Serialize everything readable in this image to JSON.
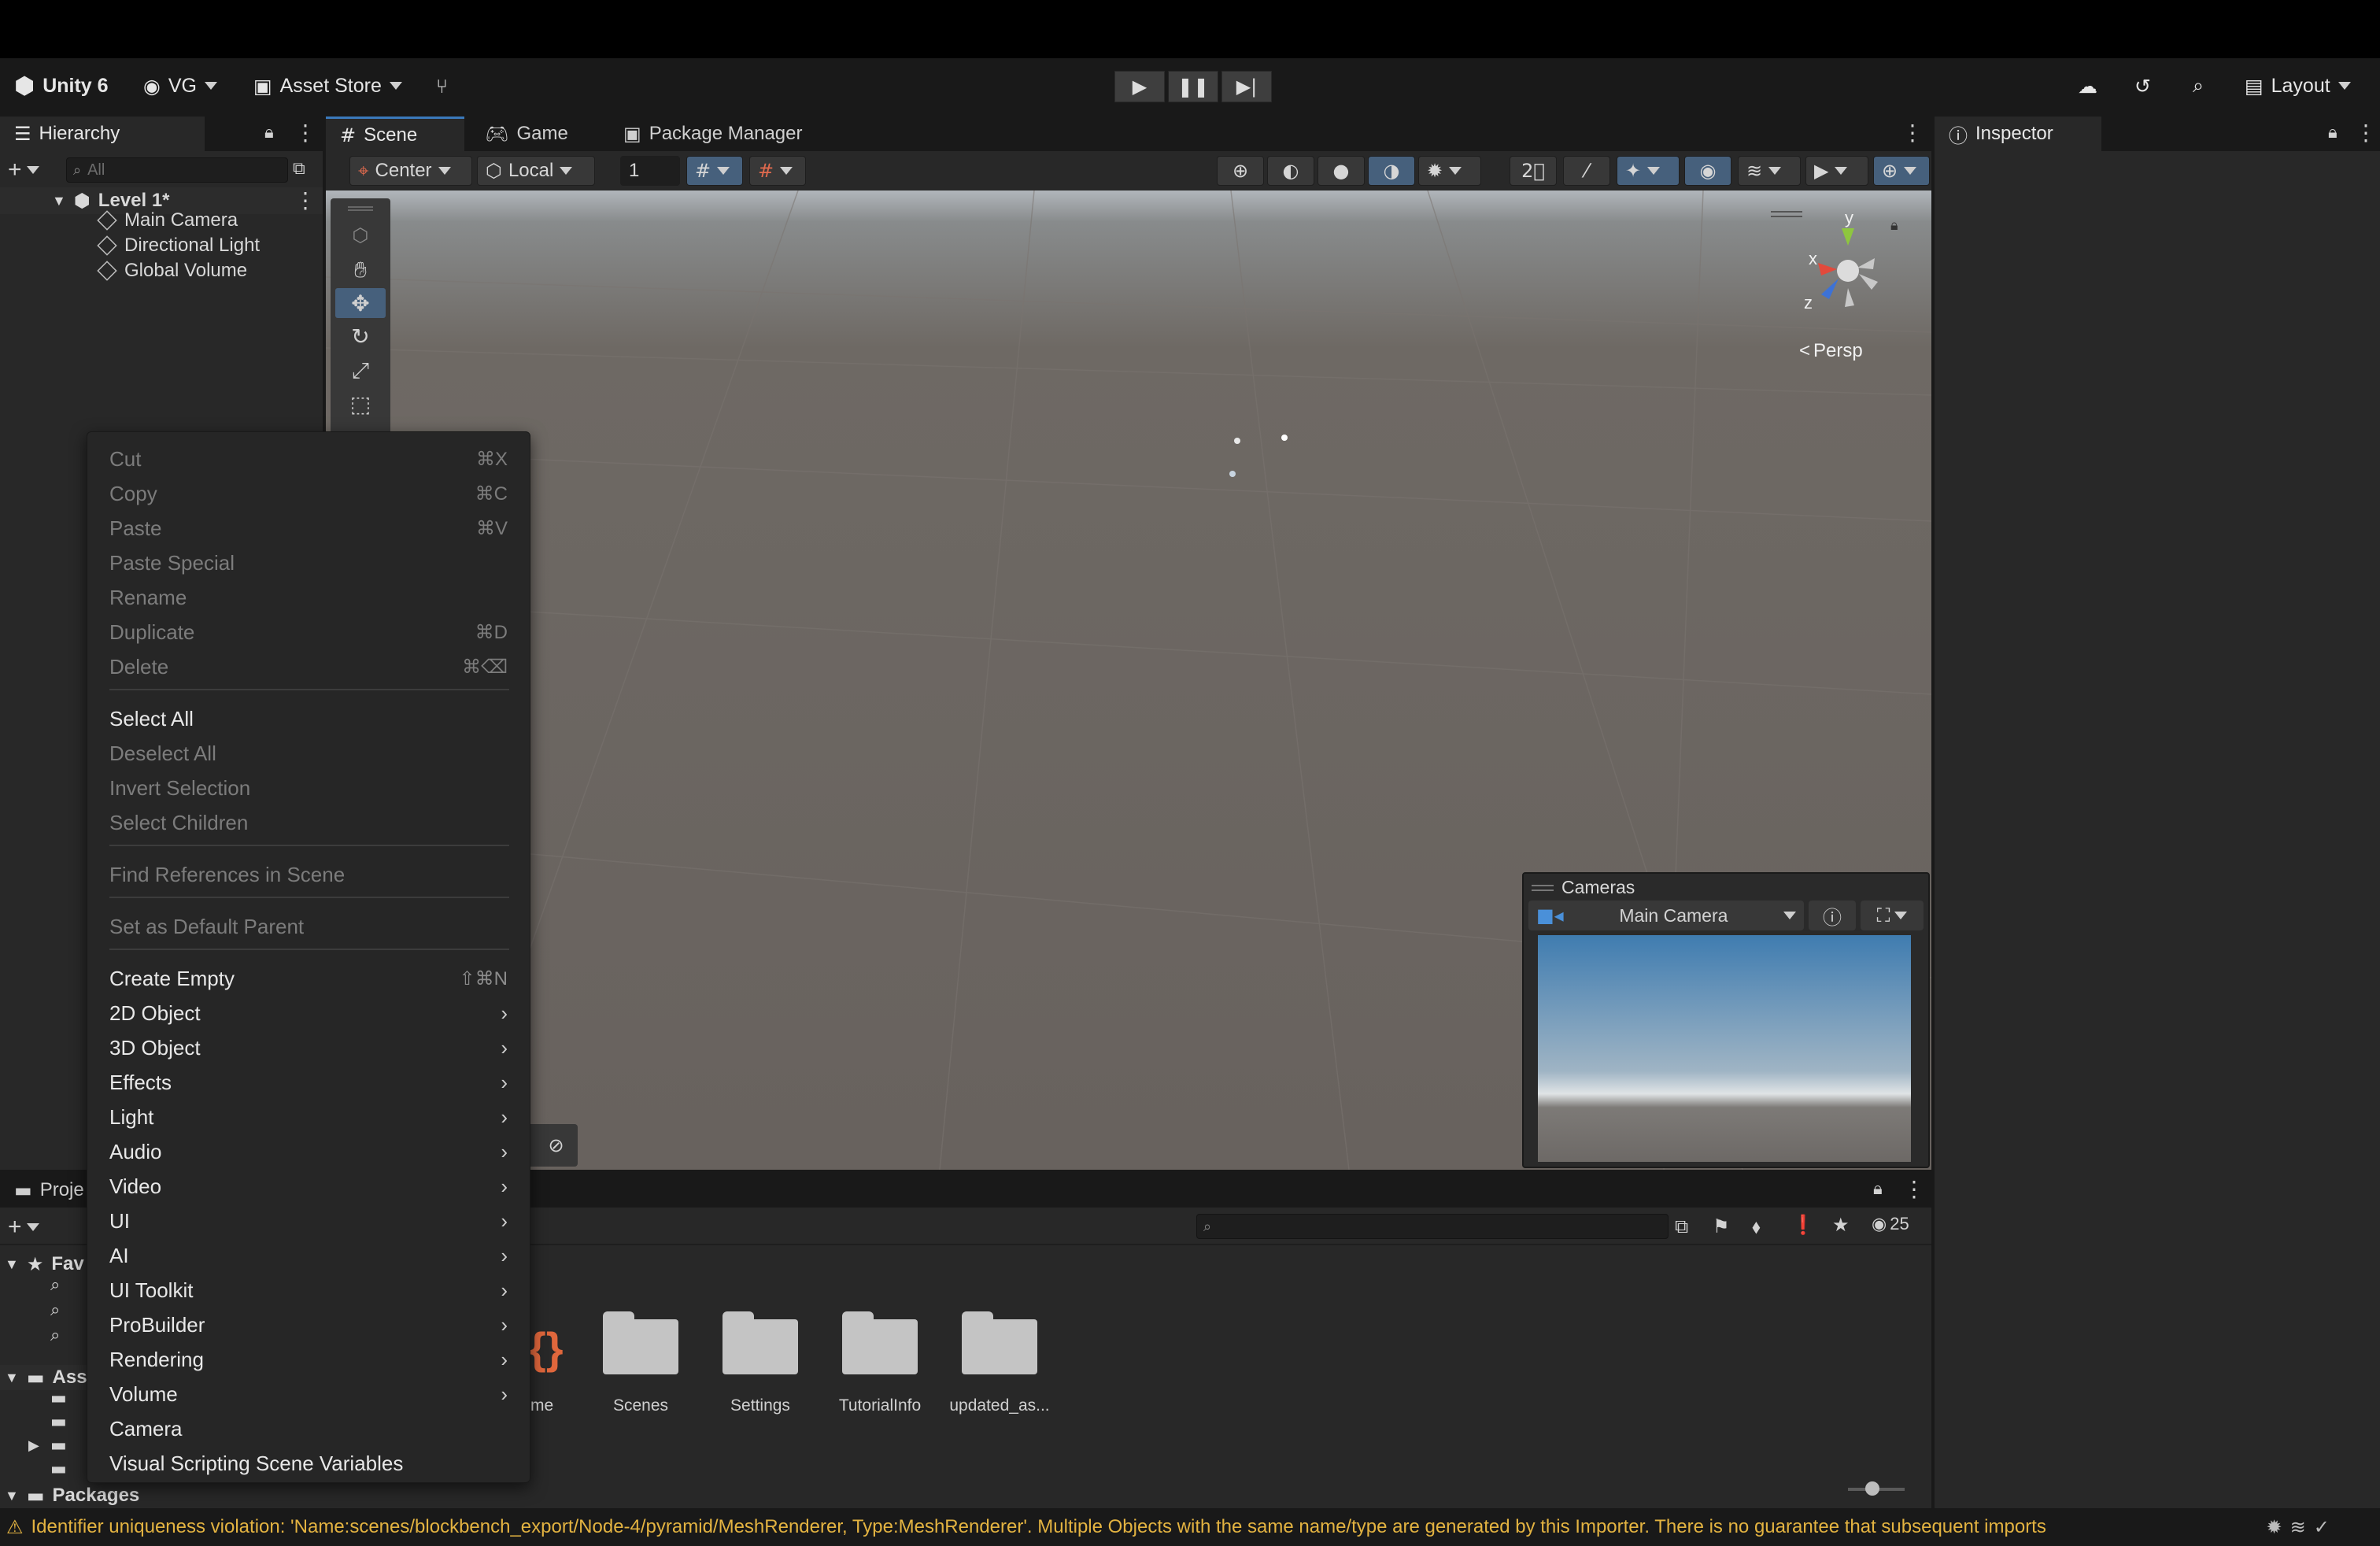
{
  "toolbar": {
    "product": "Unity 6",
    "account": "VG",
    "asset_store": "Asset Store",
    "layout": "Layout"
  },
  "hierarchy": {
    "tab": "Hierarchy",
    "search_placeholder": "All",
    "scene_name": "Level 1*",
    "items": [
      "Main Camera",
      "Directional Light",
      "Global Volume"
    ]
  },
  "scene": {
    "tabs": [
      "Scene",
      "Game",
      "Package Manager"
    ],
    "pivot": "Center",
    "space": "Local",
    "grid_value": "1",
    "persp_label": "Persp",
    "axes": {
      "x": "x",
      "y": "y",
      "z": "z"
    }
  },
  "inspector": {
    "tab": "Inspector"
  },
  "cameras": {
    "title": "Cameras",
    "selected": "Main Camera"
  },
  "context_menu": {
    "group1": [
      {
        "label": "Cut",
        "shortcut": "⌘X"
      },
      {
        "label": "Copy",
        "shortcut": "⌘C"
      },
      {
        "label": "Paste",
        "shortcut": "⌘V"
      },
      {
        "label": "Paste Special",
        "shortcut": ""
      },
      {
        "label": "Rename",
        "shortcut": ""
      },
      {
        "label": "Duplicate",
        "shortcut": "⌘D"
      },
      {
        "label": "Delete",
        "shortcut": "⌘⌫"
      }
    ],
    "group2": [
      {
        "label": "Select All",
        "enabled": true
      },
      {
        "label": "Deselect All",
        "enabled": false
      },
      {
        "label": "Invert Selection",
        "enabled": false
      },
      {
        "label": "Select Children",
        "enabled": false
      }
    ],
    "find_refs": "Find References in Scene",
    "default_parent": "Set as Default Parent",
    "create_empty": {
      "label": "Create Empty",
      "shortcut": "⇧⌘N"
    },
    "submenus": [
      "2D Object",
      "3D Object",
      "Effects",
      "Light",
      "Audio",
      "Video",
      "UI",
      "AI",
      "UI Toolkit",
      "ProBuilder",
      "Rendering",
      "Volume"
    ],
    "tail": [
      "Camera",
      "Visual Scripting Scene Variables"
    ]
  },
  "project": {
    "tab": "Proje",
    "favorites": "Fav",
    "assets": "Ass",
    "packages": "Packages",
    "folders": [
      "Scenes",
      "Settings",
      "TutorialInfo",
      "updated_as..."
    ],
    "partial_asset_label": "me",
    "hidden_count": "25"
  },
  "status": {
    "message": "Identifier uniqueness violation: 'Name:scenes/blockbench_export/Node-4/pyramid/MeshRenderer, Type:MeshRenderer'. Multiple Objects with the same name/type are generated by this Importer. There is no guarantee that subsequent imports"
  }
}
